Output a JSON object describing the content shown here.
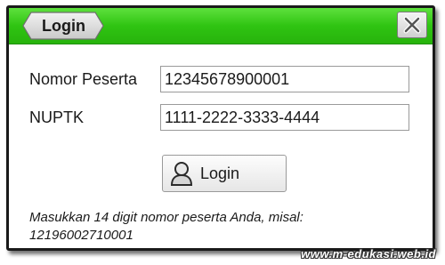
{
  "dialog": {
    "title": "Login",
    "close_icon": "close-x-icon"
  },
  "form": {
    "peserta_label": "Nomor Peserta",
    "peserta_value": "12345678900001",
    "nuptk_label": "NUPTK",
    "nuptk_value": "1111-2222-3333-4444",
    "login_button_label": "Login",
    "login_button_icon": "user-icon"
  },
  "hint": {
    "line1": "Masukkan 14 digit nomor peserta Anda, misal:",
    "line2": "12196002710001"
  },
  "watermark": "www.m-edukasi.web.id",
  "colors": {
    "titlebar_green": "#2fc412",
    "border": "#1a1a1a"
  }
}
